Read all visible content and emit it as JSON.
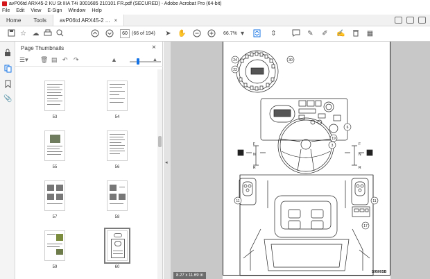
{
  "window": {
    "title": "avP06td ARX45-2 KU St IIIA T4i 3001685 210101 FR.pdf (SECURED) - Adobe Acrobat Pro (64-bit)"
  },
  "menu": [
    "File",
    "Edit",
    "View",
    "E-Sign",
    "Window",
    "Help"
  ],
  "tabs": {
    "home": "Home",
    "tools": "Tools",
    "document": "avP06td ARX45-2 ..."
  },
  "toolbar": {
    "page_value": "60",
    "page_count": "(66 of 194)",
    "zoom": "66.7%"
  },
  "panel": {
    "title": "Page Thumbnails",
    "thumbnails": [
      {
        "label": "53"
      },
      {
        "label": "54"
      },
      {
        "label": "55"
      },
      {
        "label": "56"
      },
      {
        "label": "57"
      },
      {
        "label": "58"
      },
      {
        "label": "59"
      },
      {
        "label": "60",
        "selected": true
      }
    ]
  },
  "document": {
    "page_size": "8.27 x 11.69 in",
    "figure_id": "S9500SB",
    "callouts": [
      "24",
      "30",
      "23",
      "6",
      "19",
      "3",
      "11",
      "11",
      "17"
    ],
    "gear_letters": {
      "left": [
        "F",
        "N",
        "R"
      ],
      "right": [
        "F",
        "N",
        "R"
      ]
    }
  }
}
